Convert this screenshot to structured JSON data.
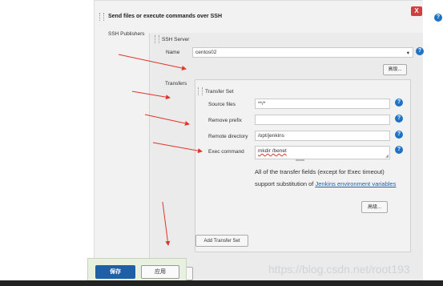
{
  "section": {
    "title": "Send files or execute commands over SSH",
    "close": "X"
  },
  "ssh_publishers_label": "SSH Publishers",
  "ssh_server": {
    "header": "SSH Server",
    "name_label": "Name",
    "name_value": "centos02",
    "advanced_button": "高级..."
  },
  "transfers": {
    "label": "Transfers",
    "set_header": "Transfer Set",
    "source_files_label": "Source files",
    "source_files_value": "**/*",
    "remove_prefix_label": "Remove prefix",
    "remove_prefix_value": "",
    "remote_directory_label": "Remote directory",
    "remote_directory_value": "/opt/jenkins",
    "exec_command_label": "Exec command",
    "exec_command_value": "mkdir /benet",
    "help_text_1": "All of the transfer fields (except for Exec timeout) support substitution of ",
    "help_link": "Jenkins environment variables",
    "advanced_button": "高级...",
    "add_button": "Add Transfer Set"
  },
  "footer": {
    "save": "保存",
    "apply": "应用"
  },
  "watermark": "https://blog.csdn.net/root193",
  "colors": {
    "help_icon": "#1e72c4",
    "close": "#d0403e",
    "save": "#1f5fa6",
    "arrow": "#e0352b"
  }
}
